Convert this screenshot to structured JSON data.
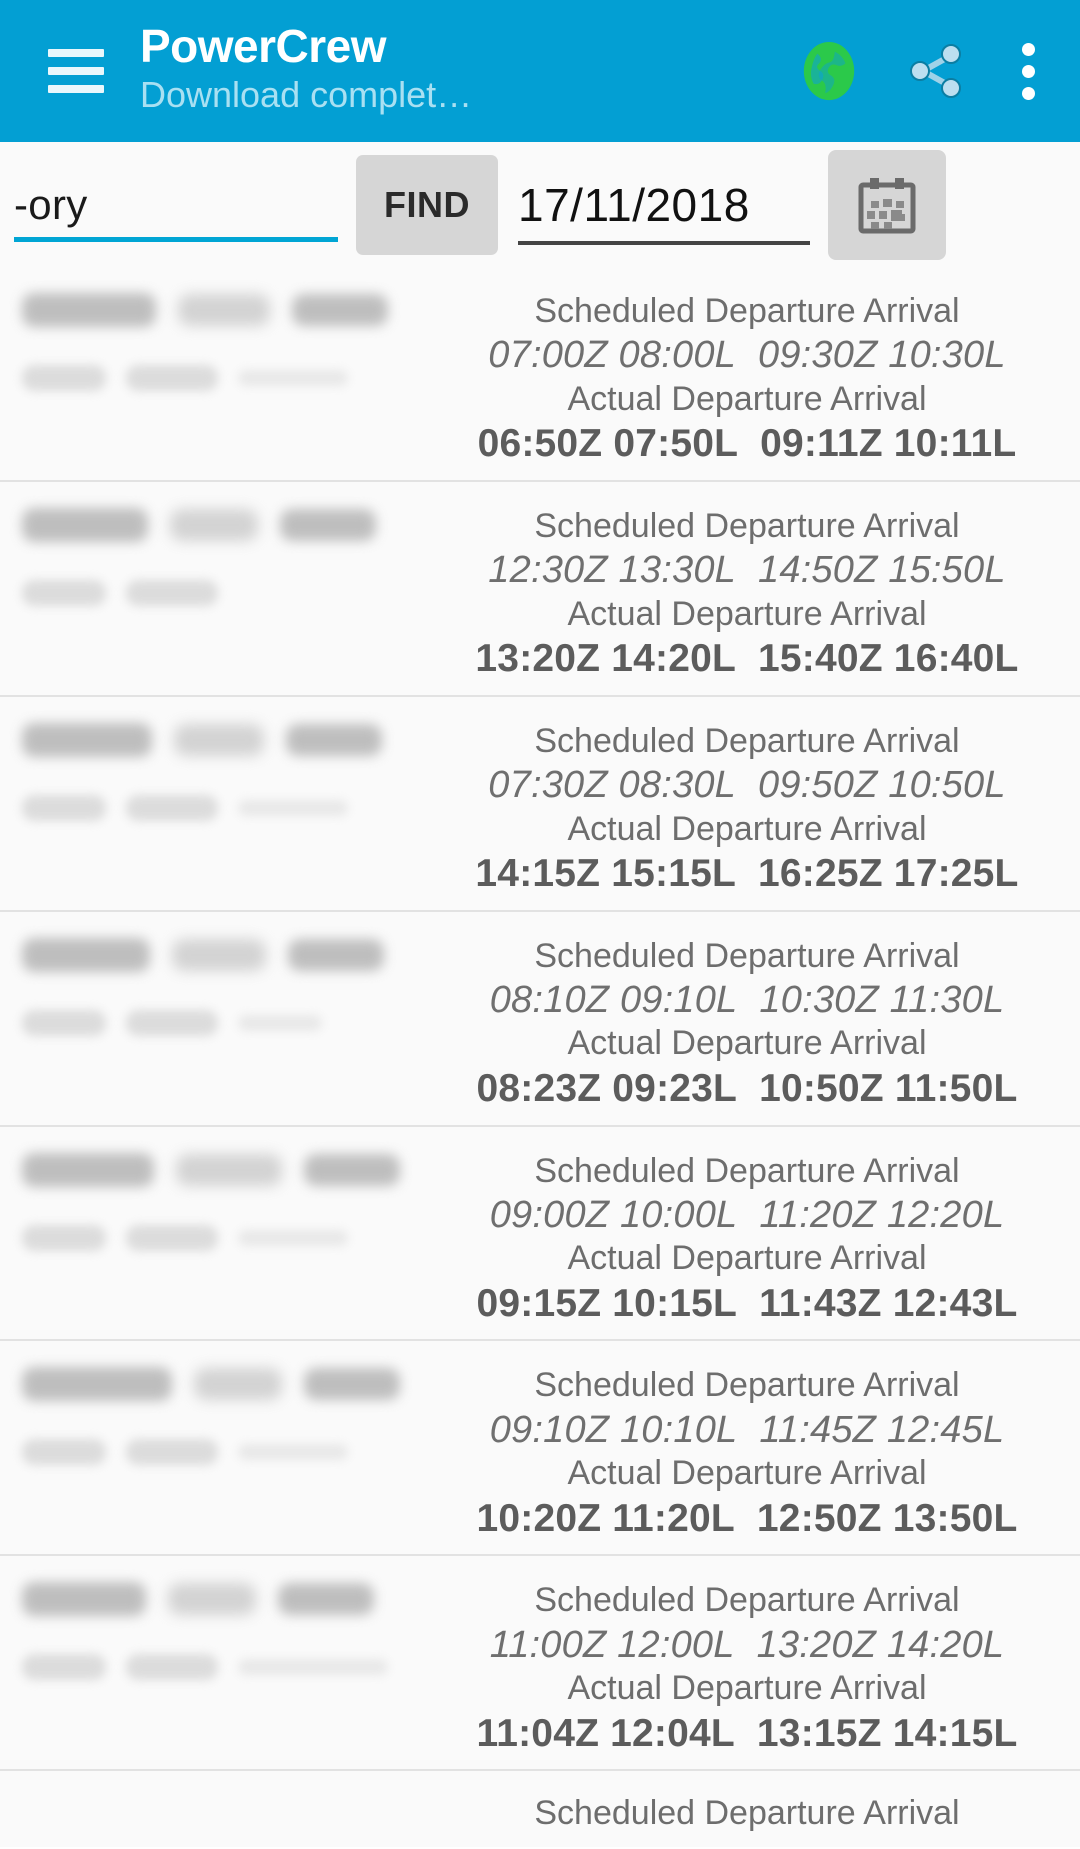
{
  "appbar": {
    "title": "PowerCrew",
    "subtitle": "Download complet…",
    "menu_icon": "hamburger-menu-icon",
    "globe_icon": "globe-icon",
    "share_icon": "share-icon",
    "overflow_icon": "more-vertical-icon",
    "background_color": "#039fd3",
    "title_color": "#ffffff",
    "subtitle_color": "#a9e0f2",
    "globe_color": "#2bc94a"
  },
  "search": {
    "term_value": "-ory",
    "find_label": "FIND",
    "date_value": "17/11/2018",
    "calendar_icon": "calendar-icon",
    "accent_color": "#00a5d4",
    "button_color": "#d6d6d6"
  },
  "labels": {
    "scheduled": "Scheduled Departure Arrival",
    "actual": "Actual Departure Arrival"
  },
  "flights": [
    {
      "scheduled_departure": "07:00Z 08:00L",
      "scheduled_arrival": "09:30Z 10:30L",
      "actual_departure": "06:50Z 07:50L",
      "actual_arrival": "09:11Z 10:11L"
    },
    {
      "scheduled_departure": "12:30Z 13:30L",
      "scheduled_arrival": "14:50Z 15:50L",
      "actual_departure": "13:20Z 14:20L",
      "actual_arrival": "15:40Z 16:40L"
    },
    {
      "scheduled_departure": "07:30Z 08:30L",
      "scheduled_arrival": "09:50Z 10:50L",
      "actual_departure": "14:15Z 15:15L",
      "actual_arrival": "16:25Z 17:25L"
    },
    {
      "scheduled_departure": "08:10Z 09:10L",
      "scheduled_arrival": "10:30Z 11:30L",
      "actual_departure": "08:23Z 09:23L",
      "actual_arrival": "10:50Z 11:50L"
    },
    {
      "scheduled_departure": "09:00Z 10:00L",
      "scheduled_arrival": "11:20Z 12:20L",
      "actual_departure": "09:15Z 10:15L",
      "actual_arrival": "11:43Z 12:43L"
    },
    {
      "scheduled_departure": "09:10Z 10:10L",
      "scheduled_arrival": "11:45Z 12:45L",
      "actual_departure": "10:20Z 11:20L",
      "actual_arrival": "12:50Z 13:50L"
    },
    {
      "scheduled_departure": "11:00Z 12:00L",
      "scheduled_arrival": "13:20Z 14:20L",
      "actual_departure": "11:04Z 12:04L",
      "actual_arrival": "13:15Z 14:15L"
    }
  ]
}
